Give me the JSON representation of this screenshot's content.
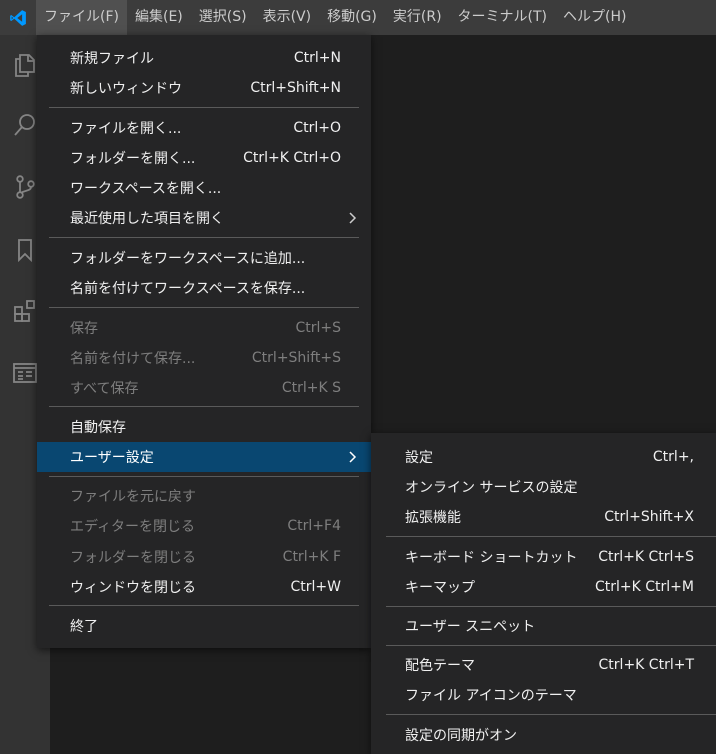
{
  "menubar": {
    "items": [
      "ファイル(F)",
      "編集(E)",
      "選択(S)",
      "表示(V)",
      "移動(G)",
      "実行(R)",
      "ターミナル(T)",
      "ヘルプ(H)"
    ]
  },
  "activity_bar": {
    "icons": [
      "explorer-icon",
      "search-icon",
      "source-control-icon",
      "bookmarks-icon",
      "extensions-icon",
      "remote-explorer-icon"
    ]
  },
  "file_menu": {
    "new_file": {
      "label": "新規ファイル",
      "key": "Ctrl+N"
    },
    "new_window": {
      "label": "新しいウィンドウ",
      "key": "Ctrl+Shift+N"
    },
    "open_file": {
      "label": "ファイルを開く...",
      "key": "Ctrl+O"
    },
    "open_folder": {
      "label": "フォルダーを開く...",
      "key": "Ctrl+K Ctrl+O"
    },
    "open_workspace": {
      "label": "ワークスペースを開く..."
    },
    "open_recent": {
      "label": "最近使用した項目を開く"
    },
    "add_folder_to_workspace": {
      "label": "フォルダーをワークスペースに追加..."
    },
    "save_workspace_as": {
      "label": "名前を付けてワークスペースを保存..."
    },
    "save": {
      "label": "保存",
      "key": "Ctrl+S"
    },
    "save_as": {
      "label": "名前を付けて保存...",
      "key": "Ctrl+Shift+S"
    },
    "save_all": {
      "label": "すべて保存",
      "key": "Ctrl+K S"
    },
    "auto_save": {
      "label": "自動保存"
    },
    "preferences": {
      "label": "ユーザー設定"
    },
    "revert_file": {
      "label": "ファイルを元に戻す"
    },
    "close_editor": {
      "label": "エディターを閉じる",
      "key": "Ctrl+F4"
    },
    "close_folder": {
      "label": "フォルダーを閉じる",
      "key": "Ctrl+K F"
    },
    "close_window": {
      "label": "ウィンドウを閉じる",
      "key": "Ctrl+W"
    },
    "exit": {
      "label": "終了"
    }
  },
  "preferences_menu": {
    "settings": {
      "label": "設定",
      "key": "Ctrl+,"
    },
    "online_services": {
      "label": "オンライン サービスの設定"
    },
    "extensions": {
      "label": "拡張機能",
      "key": "Ctrl+Shift+X"
    },
    "keyboard_shortcuts": {
      "label": "キーボード ショートカット",
      "key": "Ctrl+K Ctrl+S"
    },
    "keymaps": {
      "label": "キーマップ",
      "key": "Ctrl+K Ctrl+M"
    },
    "user_snippets": {
      "label": "ユーザー スニペット"
    },
    "color_theme": {
      "label": "配色テーマ",
      "key": "Ctrl+K Ctrl+T"
    },
    "file_icon_theme": {
      "label": "ファイル アイコンのテーマ"
    },
    "settings_sync": {
      "label": "設定の同期がオン"
    }
  },
  "colors": {
    "accent_selection": "#094771",
    "vscode_logo": "#0098ff"
  }
}
